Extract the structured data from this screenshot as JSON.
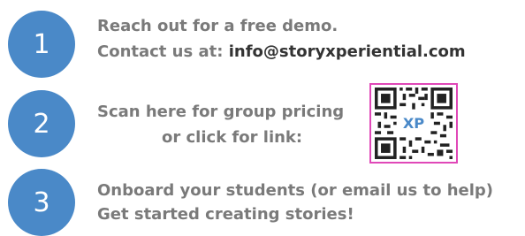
{
  "steps": [
    {
      "number": "1",
      "line1": "Reach out for a free demo.",
      "line2_prefix": "Contact us at: ",
      "line2_email": "info@storyxperiential.com"
    },
    {
      "number": "2",
      "line1": "Scan here for group pricing",
      "line2": "or click for link:"
    },
    {
      "number": "3",
      "line1": "Onboard your students (or email us to help)",
      "line2": "Get started creating stories!"
    }
  ],
  "qr": {
    "logo_text": "XP",
    "frame_color": "#e048b8"
  },
  "colors": {
    "circle": "#4a89c8",
    "text_gray": "#7a7a7a",
    "text_dark": "#333333"
  }
}
